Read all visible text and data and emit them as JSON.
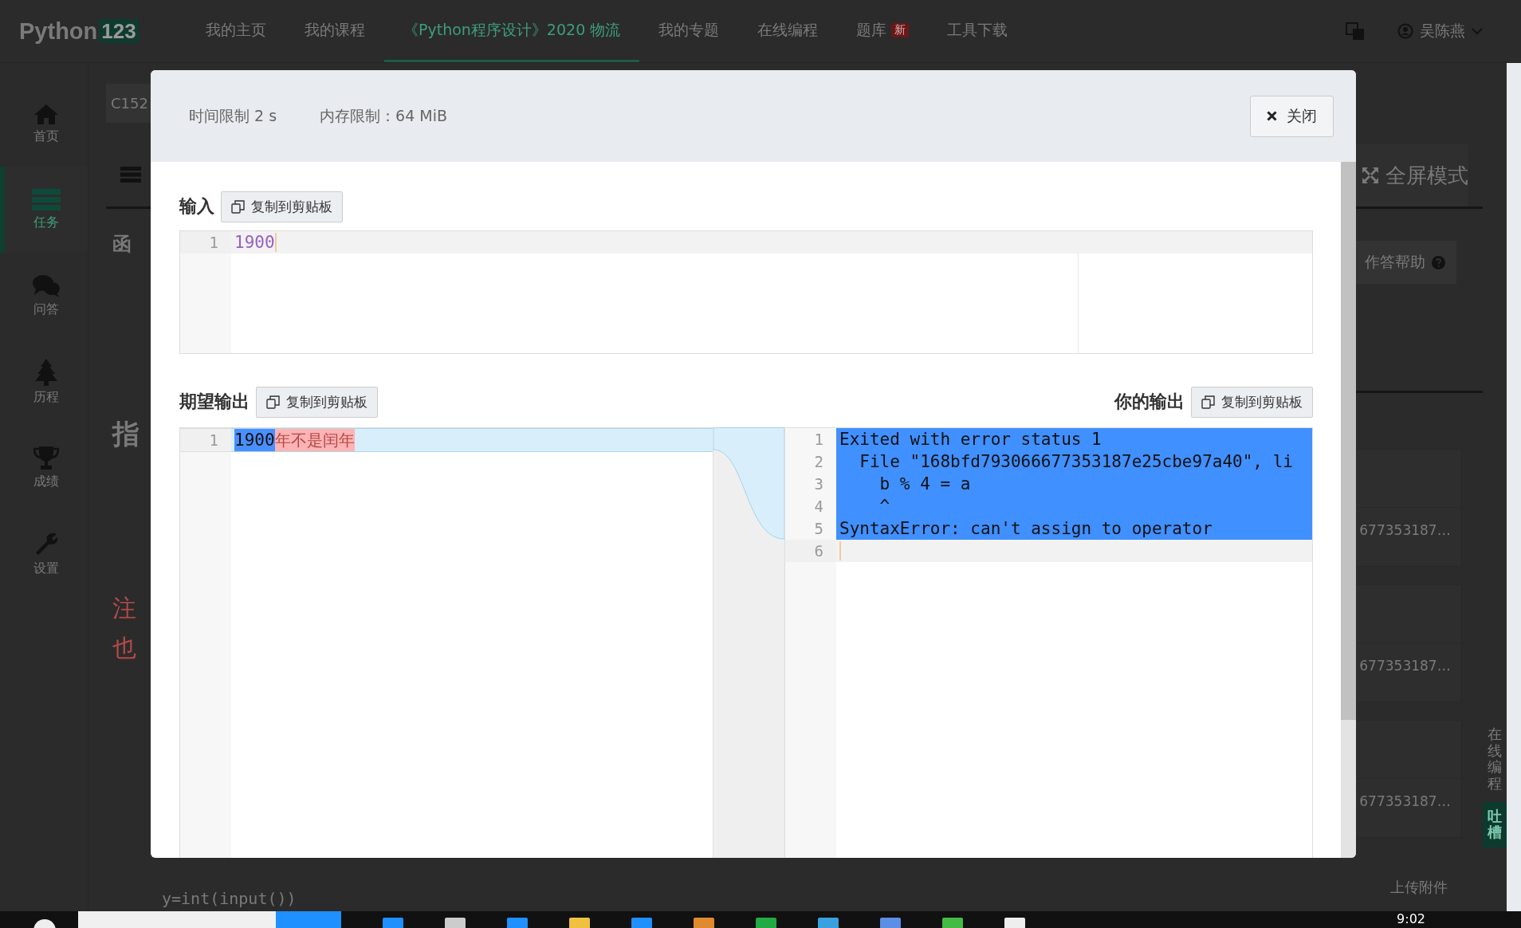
{
  "top_nav": {
    "logo": "Python",
    "logo_badge": "123",
    "items": [
      {
        "label": "我的主页",
        "selected": false
      },
      {
        "label": "我的课程",
        "selected": false
      },
      {
        "label": "《Python程序设计》2020 物流",
        "selected": true
      },
      {
        "label": "我的专题",
        "selected": false
      },
      {
        "label": "在线编程",
        "selected": false
      },
      {
        "label": "题库",
        "badge": "新",
        "selected": false
      },
      {
        "label": "工具下载",
        "selected": false
      }
    ],
    "user": "吴陈燕"
  },
  "sidebar": {
    "items": [
      {
        "label": "首页",
        "kind": "home",
        "selected": false
      },
      {
        "label": "任务",
        "kind": "tasks",
        "selected": true
      },
      {
        "label": "问答",
        "kind": "chat",
        "selected": false
      },
      {
        "label": "历程",
        "kind": "tree",
        "selected": false
      },
      {
        "label": "成绩",
        "kind": "trophy",
        "selected": false
      },
      {
        "label": "设置",
        "kind": "wrench",
        "selected": false
      }
    ]
  },
  "background": {
    "breadcrumb": "C152",
    "heading": "函",
    "title": "指",
    "notes": [
      "注",
      "也"
    ],
    "code": "y=int(input())",
    "fullscreen": "全屏模式",
    "help": "作答帮助",
    "submissions": [
      "677353187…",
      "677353187…",
      "677353187…"
    ],
    "online_coding": "在线编程",
    "feedback": "吐槽",
    "upload": "上传附件"
  },
  "modal": {
    "time_limit": "时间限制 2 s",
    "memory_limit": "内存限制：64 MiB",
    "close_button": "关闭",
    "input": {
      "label": "输入",
      "copy_button": "复制到剪贴板",
      "lines": [
        {
          "number": "1",
          "text": "1900"
        }
      ]
    },
    "expected_output": {
      "label": "期望输出",
      "copy_button": "复制到剪贴板",
      "lines": [
        {
          "number": "1",
          "segments": [
            {
              "text": "1900",
              "kind": "same"
            },
            {
              "text": "年不是闰年",
              "kind": "removed"
            }
          ]
        }
      ]
    },
    "your_output": {
      "label": "你的输出",
      "copy_button": "复制到剪贴板",
      "lines": [
        {
          "number": "1",
          "text": "Exited with error status 1",
          "highlighted": true
        },
        {
          "number": "2",
          "text": "  File \"168bfd793066677353187e25cbe97a40\", li",
          "highlighted": true
        },
        {
          "number": "3",
          "text": "    b % 4 = a",
          "highlighted": true
        },
        {
          "number": "4",
          "text": "    ^",
          "highlighted": true
        },
        {
          "number": "5",
          "text": "SyntaxError: can't assign to operator",
          "highlighted": true
        },
        {
          "number": "6",
          "highlighted": false
        }
      ]
    }
  },
  "taskbar": {
    "clock": "9:02"
  }
}
